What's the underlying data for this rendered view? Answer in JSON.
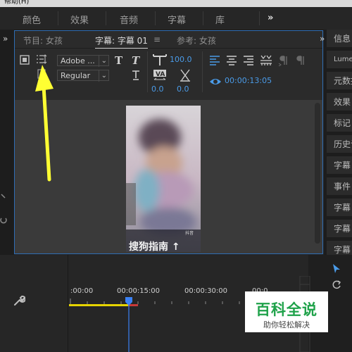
{
  "menubar": {
    "help": "帮助(H)"
  },
  "workspace": {
    "tabs": [
      "颜色",
      "效果",
      "音频",
      "字幕",
      "库"
    ],
    "more": "»"
  },
  "left_strip": {
    "chevron": "»"
  },
  "panel": {
    "tabs": [
      {
        "label": "节目: 女孩"
      },
      {
        "label": "字幕: 字幕 01",
        "active": true
      },
      {
        "label": "参考: 女孩"
      }
    ],
    "menu_icon": "≡"
  },
  "toolbar": {
    "font_family": "Adobe ...",
    "font_style": "Regular",
    "bold": "T",
    "italic": "T",
    "font_size_value": "100.0",
    "kerning_value": "0.0",
    "leading_value": "0.0",
    "timecode": "00:00:13:05"
  },
  "video": {
    "caption": "搜狗指南 ↑",
    "corner_text": "抖音"
  },
  "right_panel": {
    "chevron": "»",
    "items": [
      "信息",
      "Lumetri",
      "元数据",
      "效果",
      "标记",
      "历史记录",
      "字幕",
      "事件",
      "字幕",
      "字幕",
      "字幕",
      "字幕"
    ]
  },
  "timeline": {
    "timecodes": [
      ":00:00",
      "00:00:15:00",
      "00:00:30:00",
      "00:0"
    ]
  },
  "watermark": {
    "title": "百科全说",
    "subtitle": "助你轻松解决"
  },
  "colors": {
    "accent": "#2f6eb5",
    "timecode_blue": "#4a9be8",
    "playhead": "#3b82f6",
    "work_area": "#e6d400",
    "watermark_green": "#1fa24a",
    "annotation_arrow": "#ffff33"
  }
}
